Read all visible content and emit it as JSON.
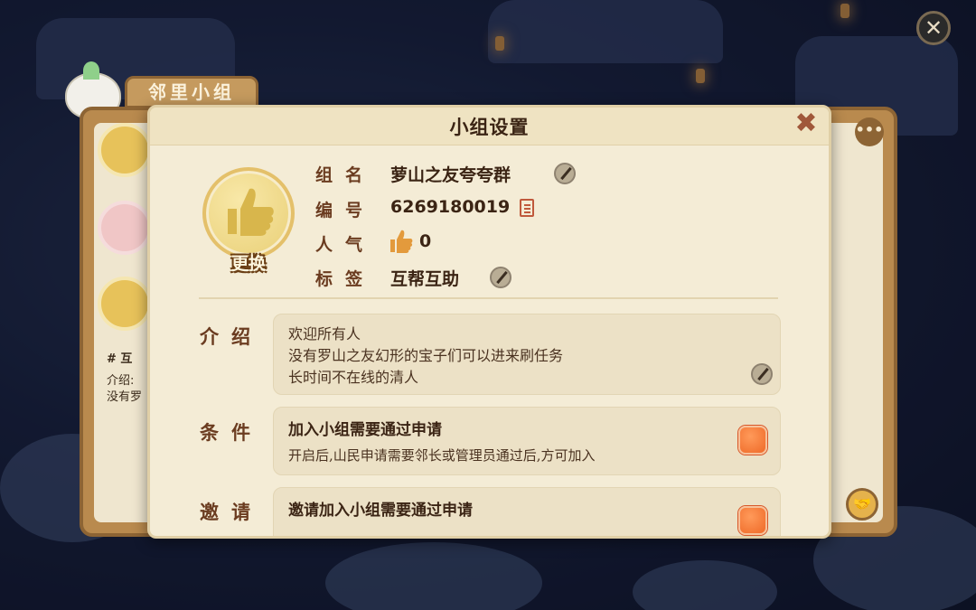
{
  "background": {
    "back_panel_tab": "邻里小组",
    "back_item_tag": "# 互",
    "back_item_intro_1": "介绍:",
    "back_item_intro_2": "没有罗"
  },
  "dialog": {
    "title": "小组设置",
    "avatar_button": "更换",
    "fields": {
      "name_label": "组名",
      "name_value": "萝山之友夸夸群",
      "id_label": "编号",
      "id_value": "6269180019",
      "popularity_label": "人气",
      "popularity_value": "0",
      "tag_label": "标签",
      "tag_value": "互帮互助"
    },
    "intro": {
      "label": "介绍",
      "lines": [
        "欢迎所有人",
        "没有罗山之友幻形的宝子们可以进来刷任务",
        "长时间不在线的清人"
      ]
    },
    "condition": {
      "label": "条件",
      "title": "加入小组需要通过申请",
      "desc": "开启后,山民申请需要邻长或管理员通过后,方可加入",
      "enabled": true
    },
    "invite": {
      "label": "邀请",
      "title": "邀请加入小组需要通过申请",
      "enabled": true
    }
  },
  "colors": {
    "accent_orange": "#ef6a28",
    "panel_bg": "#f4ecd6",
    "label_brown": "#6b3c20"
  }
}
